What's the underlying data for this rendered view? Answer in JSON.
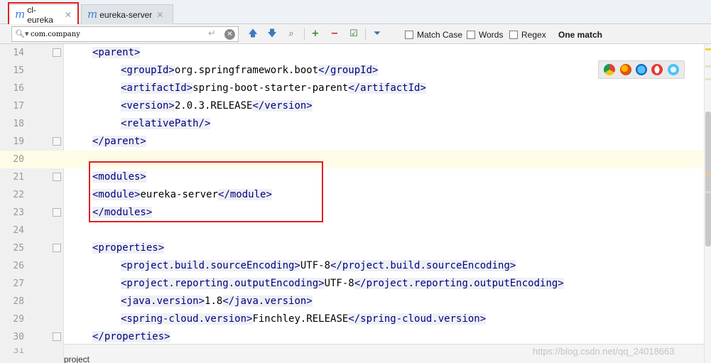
{
  "tabs": [
    {
      "icon": "maven-m-icon",
      "label": "cl-eureka",
      "active": true
    },
    {
      "icon": "maven-m-icon",
      "label": "eureka-server",
      "active": false
    }
  ],
  "search": {
    "value": "com.company",
    "options": [
      {
        "label": "Match Case",
        "checked": false
      },
      {
        "label": "Words",
        "checked": false
      },
      {
        "label": "Regex",
        "checked": false
      }
    ],
    "result": "One match"
  },
  "editor": {
    "lines": [
      {
        "num": "14",
        "indent": 1,
        "parts": [
          {
            "t": "<parent>",
            "tag": true
          }
        ]
      },
      {
        "num": "15",
        "indent": 2,
        "parts": [
          {
            "t": "<groupId>",
            "tag": true
          },
          {
            "t": "org.springframework.boot",
            "tag": false
          },
          {
            "t": "</groupId>",
            "tag": true
          }
        ]
      },
      {
        "num": "16",
        "indent": 2,
        "parts": [
          {
            "t": "<artifactId>",
            "tag": true
          },
          {
            "t": "spring-boot-starter-parent",
            "tag": false
          },
          {
            "t": "</artifactId>",
            "tag": true
          }
        ]
      },
      {
        "num": "17",
        "indent": 2,
        "parts": [
          {
            "t": "<version>",
            "tag": true
          },
          {
            "t": "2.0.3.RELEASE",
            "tag": false
          },
          {
            "t": "</version>",
            "tag": true
          }
        ]
      },
      {
        "num": "18",
        "indent": 2,
        "parts": [
          {
            "t": "<relativePath/>",
            "tag": true
          }
        ]
      },
      {
        "num": "19",
        "indent": 1,
        "parts": [
          {
            "t": "</parent>",
            "tag": true
          }
        ]
      },
      {
        "num": "20",
        "indent": 0,
        "highlight": true,
        "parts": []
      },
      {
        "num": "21",
        "indent": 1,
        "parts": [
          {
            "t": "<modules>",
            "tag": true
          }
        ]
      },
      {
        "num": "22",
        "indent": 1,
        "parts": [
          {
            "t": "<module>",
            "tag": true
          },
          {
            "t": "eureka-server",
            "tag": false
          },
          {
            "t": "</module>",
            "tag": true
          }
        ]
      },
      {
        "num": "23",
        "indent": 1,
        "parts": [
          {
            "t": "</modules>",
            "tag": true
          }
        ]
      },
      {
        "num": "24",
        "indent": 0,
        "parts": []
      },
      {
        "num": "25",
        "indent": 1,
        "parts": [
          {
            "t": "<properties>",
            "tag": true
          }
        ]
      },
      {
        "num": "26",
        "indent": 2,
        "parts": [
          {
            "t": "<project.build.sourceEncoding>",
            "tag": true
          },
          {
            "t": "UTF-8",
            "tag": false
          },
          {
            "t": "</project.build.sourceEncoding>",
            "tag": true
          }
        ]
      },
      {
        "num": "27",
        "indent": 2,
        "parts": [
          {
            "t": "<project.reporting.outputEncoding>",
            "tag": true
          },
          {
            "t": "UTF-8",
            "tag": false
          },
          {
            "t": "</project.reporting.outputEncoding>",
            "tag": true
          }
        ]
      },
      {
        "num": "28",
        "indent": 2,
        "parts": [
          {
            "t": "<java.version>",
            "tag": true
          },
          {
            "t": "1.8",
            "tag": false
          },
          {
            "t": "</java.version>",
            "tag": true
          }
        ]
      },
      {
        "num": "29",
        "indent": 2,
        "parts": [
          {
            "t": "<spring-cloud.version>",
            "tag": true
          },
          {
            "t": "Finchley.RELEASE",
            "tag": false
          },
          {
            "t": "</spring-cloud.version>",
            "tag": true
          }
        ]
      },
      {
        "num": "30",
        "indent": 1,
        "parts": [
          {
            "t": "</properties>",
            "tag": true
          }
        ]
      }
    ],
    "partial_line_num": "31"
  },
  "status": {
    "breadcrumb": "project",
    "watermark": "https://blog.csdn.net/qq_24018663"
  },
  "browser_icons": [
    "chrome-icon",
    "firefox-icon",
    "safari-icon",
    "opera-icon",
    "ie-icon"
  ],
  "colors": {
    "tag": "#000080",
    "tag_bg": "#eef0f3",
    "highlight_line": "#fefbe6",
    "annotation_red": "#e02020"
  }
}
